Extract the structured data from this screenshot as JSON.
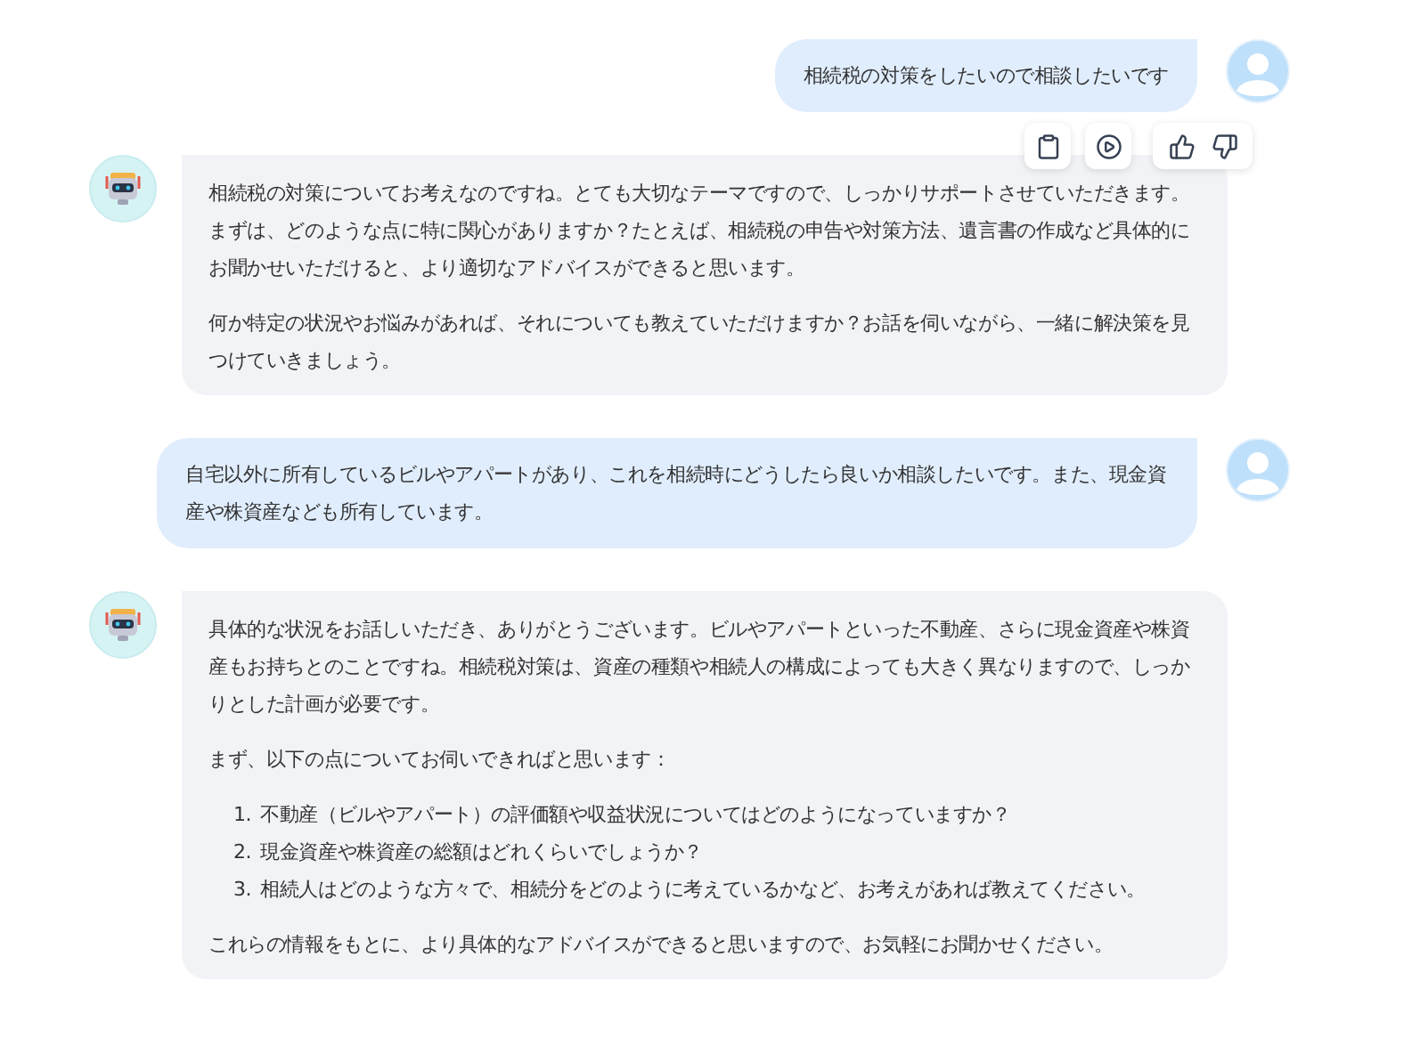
{
  "messages": [
    {
      "kind": "user",
      "paragraphs": [
        "相続税の対策をしたいので相談したいです"
      ]
    },
    {
      "kind": "assistant",
      "actions": true,
      "paragraphs": [
        "相続税の対策についてお考えなのですね。とても大切なテーマですので、しっかりサポートさせていただきます。まずは、どのような点に特に関心がありますか？たとえば、相続税の申告や対策方法、遺言書の作成など具体的にお聞かせいただけると、より適切なアドバイスができると思います。",
        "何か特定の状況やお悩みがあれば、それについても教えていただけますか？お話を伺いながら、一緒に解決策を見つけていきましょう。"
      ]
    },
    {
      "kind": "user",
      "paragraphs": [
        "自宅以外に所有しているビルやアパートがあり、これを相続時にどうしたら良いか相談したいです。また、現金資産や株資産なども所有しています。"
      ]
    },
    {
      "kind": "assistant",
      "actions": false,
      "paragraphs": [
        "具体的な状況をお話しいただき、ありがとうございます。ビルやアパートといった不動産、さらに現金資産や株資産もお持ちとのことですね。相続税対策は、資産の種類や相続人の構成によっても大きく異なりますので、しっかりとした計画が必要です。",
        "まず、以下の点についてお伺いできればと思います："
      ],
      "list": [
        {
          "number": "1.",
          "text": "不動産（ビルやアパート）の評価額や収益状況についてはどのようになっていますか？"
        },
        {
          "number": "2.",
          "text": "現金資産や株資産の総額はどれくらいでしょうか？"
        },
        {
          "number": "3.",
          "text": "相続人はどのような方々で、相続分をどのように考えているかなど、お考えがあれば教えてください。"
        }
      ],
      "closing": "これらの情報をもとに、より具体的なアドバイスができると思いますので、お気軽にお聞かせください。"
    }
  ]
}
